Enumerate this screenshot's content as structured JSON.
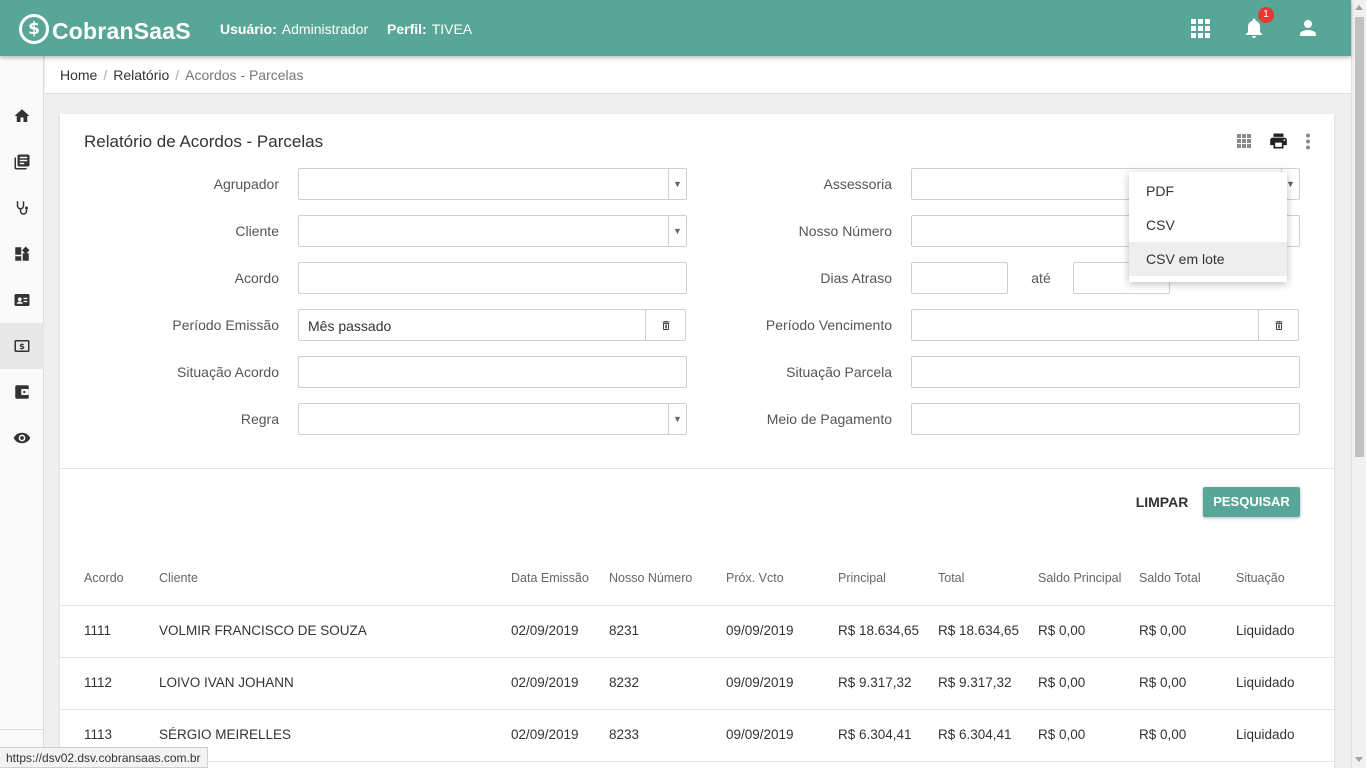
{
  "app": {
    "brand_symbol": "$",
    "brand": "CobranSaaS"
  },
  "header": {
    "user_label": "Usuário:",
    "user_value": "Administrador",
    "profile_label": "Perfil:",
    "profile_value": "TIVEA",
    "notification_count": "1",
    "icons": [
      "apps-grid-icon",
      "bell-icon",
      "account-icon"
    ]
  },
  "sidebar": {
    "items": [
      {
        "icon": "home-icon"
      },
      {
        "icon": "library-books-icon"
      },
      {
        "icon": "stethoscope-icon"
      },
      {
        "icon": "dashboard-icon"
      },
      {
        "icon": "contact-card-icon"
      },
      {
        "icon": "money-icon",
        "active": true
      },
      {
        "icon": "wallet-icon"
      },
      {
        "icon": "eye-icon"
      }
    ]
  },
  "breadcrumb": {
    "home": "Home",
    "report": "Relatório",
    "current": "Acordos - Parcelas"
  },
  "page": {
    "title": "Relatório de Acordos - Parcelas"
  },
  "form": {
    "agrupador": {
      "label": "Agrupador",
      "value": ""
    },
    "cliente": {
      "label": "Cliente",
      "value": ""
    },
    "acordo": {
      "label": "Acordo",
      "value": ""
    },
    "periodo_emissao": {
      "label": "Período Emissão",
      "value": "Mês passado"
    },
    "situacao_acordo": {
      "label": "Situação Acordo",
      "value": ""
    },
    "regra": {
      "label": "Regra",
      "value": ""
    },
    "assessoria": {
      "label": "Assessoria",
      "value": ""
    },
    "nosso_numero": {
      "label": "Nosso Número",
      "value": ""
    },
    "dias_atraso": {
      "label": "Dias Atraso",
      "from": "",
      "to_label": "até",
      "to": ""
    },
    "periodo_vencimento": {
      "label": "Período Vencimento",
      "value": ""
    },
    "situacao_parcela": {
      "label": "Situação Parcela",
      "value": ""
    },
    "meio_pagamento": {
      "label": "Meio de Pagamento",
      "value": ""
    }
  },
  "actions": {
    "clear": "LIMPAR",
    "search": "PESQUISAR"
  },
  "export_menu": {
    "items": [
      "PDF",
      "CSV",
      "CSV em lote"
    ],
    "highlighted": "CSV em lote"
  },
  "table": {
    "columns": [
      "Acordo",
      "Cliente",
      "Data Emissão",
      "Nosso Número",
      "Próx. Vcto",
      "Principal",
      "Total",
      "Saldo Principal",
      "Saldo Total",
      "Situação"
    ],
    "rows": [
      [
        "1111",
        "VOLMIR FRANCISCO DE SOUZA",
        "02/09/2019",
        "8231",
        "09/09/2019",
        "R$ 18.634,65",
        "R$ 18.634,65",
        "R$ 0,00",
        "R$ 0,00",
        "Liquidado"
      ],
      [
        "1112",
        "LOIVO IVAN JOHANN",
        "02/09/2019",
        "8232",
        "09/09/2019",
        "R$ 9.317,32",
        "R$ 9.317,32",
        "R$ 0,00",
        "R$ 0,00",
        "Liquidado"
      ],
      [
        "1113",
        "SÉRGIO MEIRELLES",
        "02/09/2019",
        "8233",
        "09/09/2019",
        "R$ 6.304,41",
        "R$ 6.304,41",
        "R$ 0,00",
        "R$ 0,00",
        "Liquidado"
      ]
    ]
  },
  "status_bar": {
    "url": "https://dsv02.dsv.cobransaas.com.br"
  }
}
